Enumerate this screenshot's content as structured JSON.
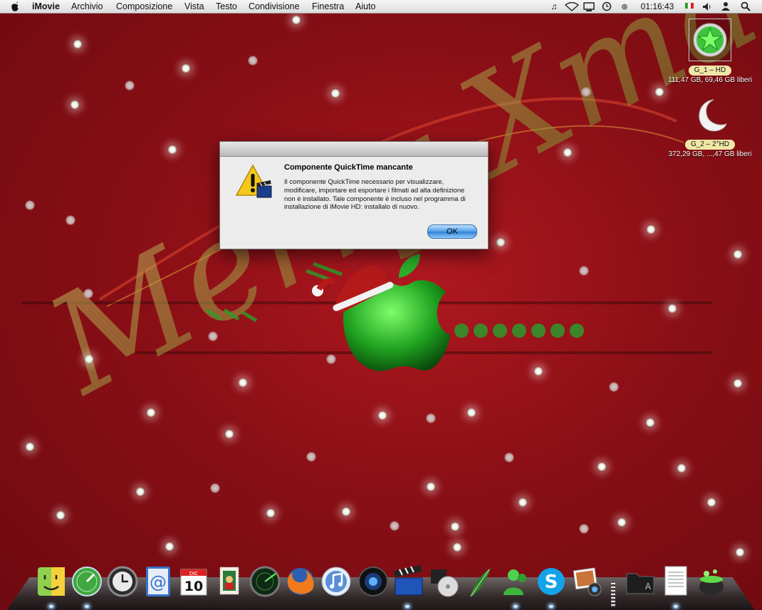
{
  "menubar": {
    "app_name": "iMovie",
    "menus": [
      "Archivio",
      "Composizione",
      "Vista",
      "Testo",
      "Condivisione",
      "Finestra",
      "Aiuto"
    ],
    "clock": "01:16:43",
    "status_icons": [
      "music-note-icon",
      "wifi-icon",
      "display-icon",
      "time-machine-icon",
      "bluetooth-icon",
      "flag-icon",
      "volume-icon",
      "user-icon",
      "spotlight-icon"
    ]
  },
  "wallpaper": {
    "text": "Merry Xmas"
  },
  "desktop_icons": [
    {
      "label": "G_1 – HD",
      "info": "111,47 GB, 69,46 GB liberi"
    },
    {
      "label": "G_2 – 2°HD",
      "info": "372,29 GB, ...,47 GB liberi"
    }
  ],
  "dialog": {
    "title": "Componente QuickTime mancante",
    "message": "Il componente QuickTime necessario per visualizzare, modificare, importare ed esportare i filmati ad alta definizione non è installato. Tale componente è incluso nel programma di installazione di iMovie HD: installalo di nuovo.",
    "ok_label": "OK"
  },
  "dock": {
    "items": [
      "finder",
      "dashboard",
      "time-machine",
      "mail",
      "ical",
      "stamps",
      "network-radar",
      "firefox",
      "itunes",
      "camera",
      "imovie",
      "dvd",
      "quill",
      "messenger",
      "skype",
      "iphoto",
      "folder",
      "textedit",
      "cauldron"
    ],
    "ical_month": "DIC",
    "ical_day": "10"
  },
  "colors": {
    "wallpaper": "#8a0f16",
    "apple_logo": "#2bb02b",
    "ok_button": "#4f9fe8"
  }
}
